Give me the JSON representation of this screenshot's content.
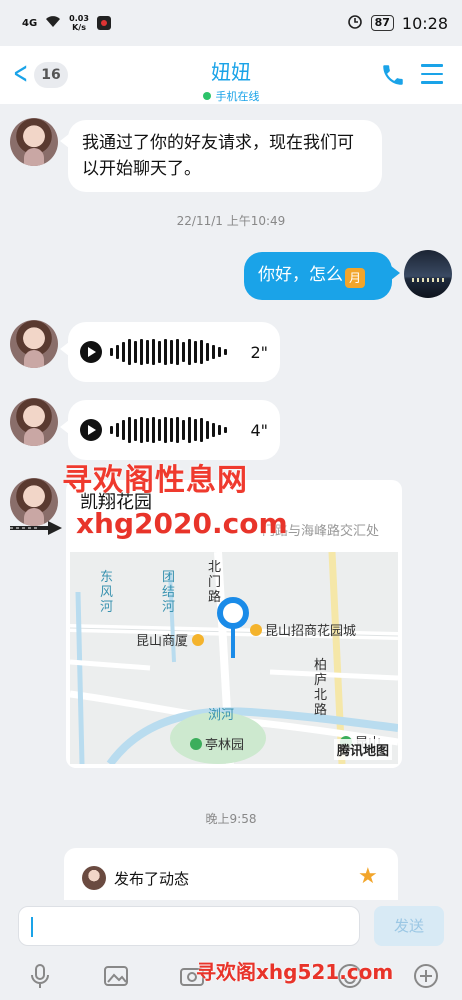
{
  "status_bar": {
    "signal": "4G",
    "net_speed_value": "0.03",
    "net_speed_unit": "K/s",
    "battery": "87",
    "time": "10:28"
  },
  "header": {
    "unread_count": "16",
    "contact_name": "妞妞",
    "status": "手机在线"
  },
  "messages": {
    "system_added": "我通过了你的好友请求，现在我们可以开始聊天了。",
    "time1": "22/11/1 上午10:49",
    "my_greeting": "你好，怎么",
    "my_emoji": "月",
    "voice1_duration": "2\"",
    "voice2_duration": "4\"",
    "time2": "晚上9:58"
  },
  "location": {
    "name": "凯翔花园",
    "address": "门路与海峰路交汇处",
    "map_labels": {
      "river1": "东风河",
      "river2": "团结河",
      "road_north": "北门路",
      "poi_mall": "昆山商厦",
      "poi_estate": "昆山招商花园城",
      "road_bailu": "柏庐北路",
      "river3": "浏河",
      "park": "亭林园",
      "poi_kunshan": "昆山",
      "brand": "腾讯地图"
    }
  },
  "feed": {
    "text": "发布了动态"
  },
  "input": {
    "send_label": "发送"
  },
  "watermarks": {
    "wm1": "寻欢阁性息网",
    "wm2": "xhg2020.com",
    "wm3": "寻欢阁xhg521.com"
  },
  "colors": {
    "accent": "#1aa3e8",
    "online": "#2dc36a"
  }
}
